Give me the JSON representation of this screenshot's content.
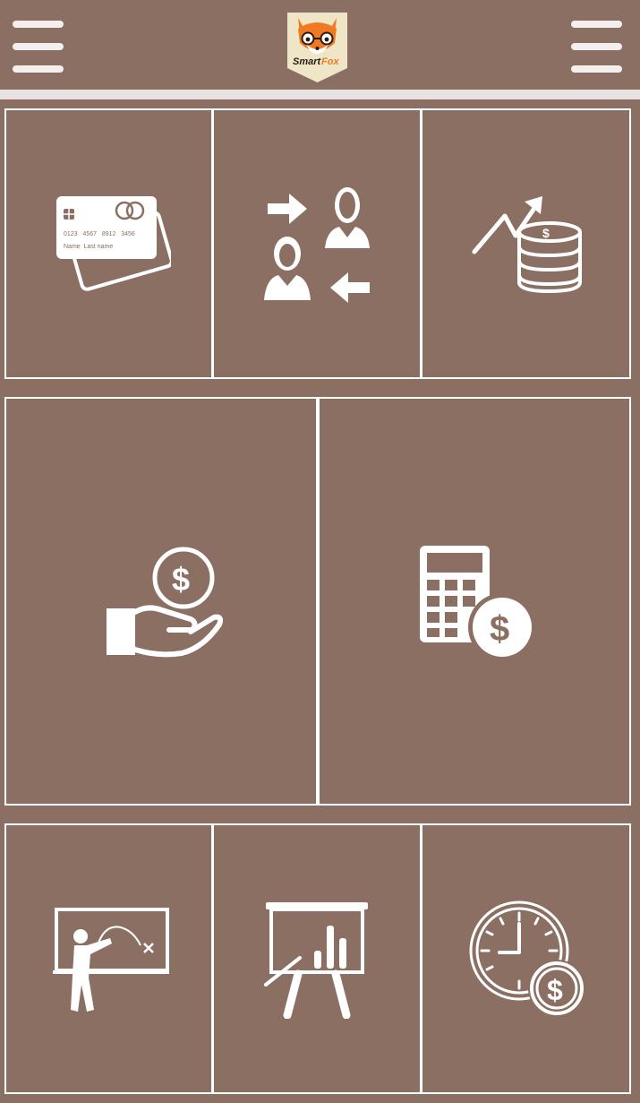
{
  "header": {
    "logo_text_1": "Smart",
    "logo_text_2": "Fox",
    "left_menu_icon": "hamburger-menu-icon",
    "right_menu_icon": "hamburger-menu-icon"
  },
  "card": {
    "number": "0123   4567   8912   3456",
    "name": "Name  Last name"
  },
  "colors": {
    "background": "#8b6f63",
    "icon": "#ffffff",
    "divider": "#e8e2e0",
    "logo_orange": "#f07a22",
    "logo_bg": "#efe6c8"
  },
  "tiles": [
    {
      "icon": "credit-card-icon"
    },
    {
      "icon": "money-transfer-icon"
    },
    {
      "icon": "investment-growth-icon"
    },
    {
      "icon": "hand-coin-icon"
    },
    {
      "icon": "calculator-dollar-icon"
    },
    {
      "icon": "training-presentation-icon"
    },
    {
      "icon": "chart-presentation-icon"
    },
    {
      "icon": "clock-dollar-icon"
    }
  ]
}
